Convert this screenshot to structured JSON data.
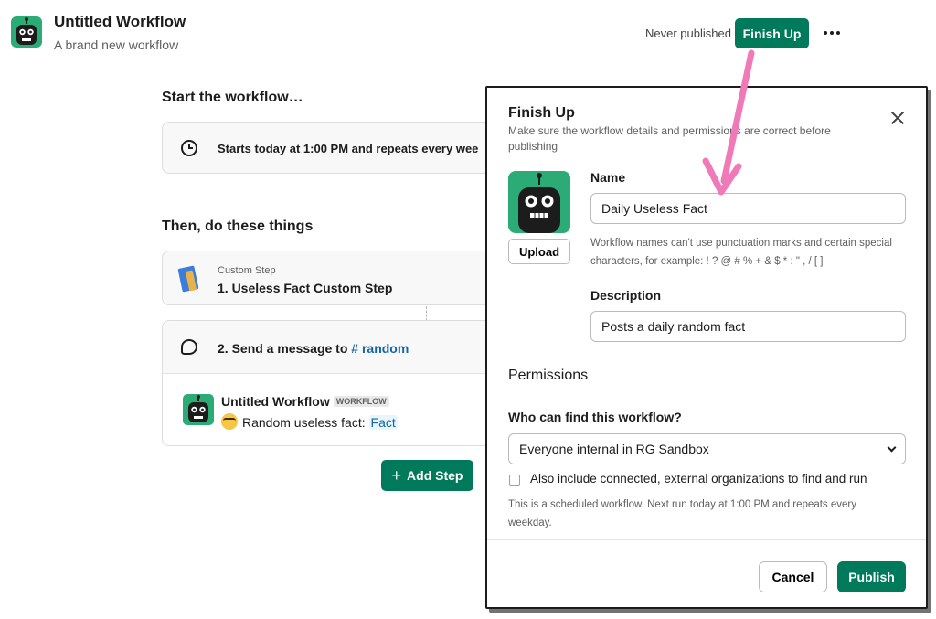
{
  "header": {
    "title": "Untitled Workflow",
    "subtitle": "A brand new workflow",
    "status": "Never published",
    "finish_label": "Finish Up"
  },
  "builder": {
    "start_heading": "Start the workflow…",
    "trigger_text": "Starts today at 1:00 PM and repeats every wee",
    "then_heading": "Then, do these things",
    "step1": {
      "kind": "Custom Step",
      "title": "1. Useless Fact Custom Step"
    },
    "step2": {
      "title_prefix": "2. Send a message to",
      "channel": "# random",
      "message": {
        "author": "Untitled Workflow",
        "badge": "WORKFLOW",
        "text": "Random useless fact:",
        "token": "Fact"
      }
    },
    "add_step_label": "Add Step"
  },
  "modal": {
    "title": "Finish Up",
    "subtitle": "Make sure the workflow details and permissions are correct before publishing",
    "upload_label": "Upload",
    "name_label": "Name",
    "name_value": "Daily Useless Fact",
    "name_hint": "Workflow names can't use punctuation marks and certain special characters, for example: ! ? @ # % + & $ * : \" , / [ ]",
    "description_label": "Description",
    "description_value": "Posts a daily random fact",
    "permissions_heading": "Permissions",
    "who_label": "Who can find this workflow?",
    "who_value": "Everyone internal in RG Sandbox",
    "external_label": "Also include connected, external organizations to find and run",
    "external_checked": false,
    "schedule_note": "This is a scheduled workflow. Next run today at 1:00 PM and repeats every weekday.",
    "cancel_label": "Cancel",
    "publish_label": "Publish"
  },
  "icons": [
    "robot-avatar",
    "more-icon",
    "clock-icon",
    "book-icon",
    "message-icon",
    "plus-icon",
    "close-icon",
    "chevron-down-icon",
    "nerd-emoji"
  ],
  "colors": {
    "primary": "#007a5a",
    "avatar": "#2bac76",
    "link": "#1264a3",
    "annotation_arrow": "#f07ab8"
  }
}
